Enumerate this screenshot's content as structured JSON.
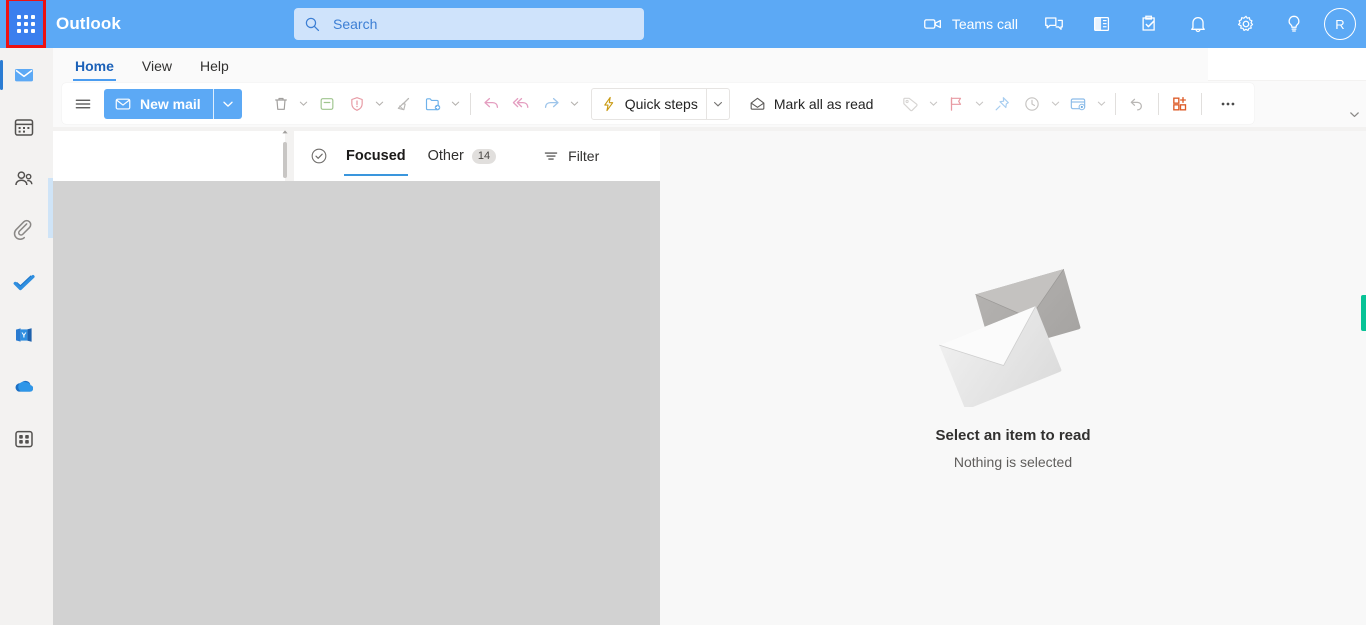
{
  "header": {
    "brand": "Outlook",
    "app_launcher_icon": "waffle-grid-icon",
    "search": {
      "placeholder": "Search",
      "icon": "search-icon"
    },
    "actions": [
      {
        "name": "teams-call",
        "label": "Teams call",
        "icon": "video-camera-icon"
      },
      {
        "name": "chat",
        "label": "",
        "icon": "chat-bubble-icon"
      },
      {
        "name": "office-apps",
        "label": "",
        "icon": "office-app-icon"
      },
      {
        "name": "tasks",
        "label": "",
        "icon": "task-checklist-icon"
      },
      {
        "name": "notifications",
        "label": "",
        "icon": "bell-icon"
      },
      {
        "name": "settings",
        "label": "",
        "icon": "gear-icon"
      },
      {
        "name": "help",
        "label": "",
        "icon": "lightbulb-icon"
      }
    ],
    "avatar_initial": "R"
  },
  "rail": {
    "items": [
      {
        "name": "mail",
        "icon": "mail-icon",
        "active": true
      },
      {
        "name": "calendar",
        "icon": "calendar-icon",
        "active": false
      },
      {
        "name": "people",
        "icon": "people-icon",
        "active": false
      },
      {
        "name": "files",
        "icon": "paperclip-icon",
        "active": false
      },
      {
        "name": "to-do",
        "icon": "checkmark-icon",
        "active": false
      },
      {
        "name": "viva-engage",
        "icon": "yammer-icon",
        "active": false
      },
      {
        "name": "onedrive",
        "icon": "cloud-icon",
        "active": false
      },
      {
        "name": "more-apps",
        "icon": "apps-grid-icon",
        "active": false
      }
    ]
  },
  "ribbon_tabs": [
    {
      "label": "Home",
      "selected": true
    },
    {
      "label": "View",
      "selected": false
    },
    {
      "label": "Help",
      "selected": false
    }
  ],
  "toolbar": {
    "menu_icon": "hamburger-icon",
    "new_mail_label": "New mail",
    "new_mail_icon": "envelope-icon",
    "new_mail_caret": "chevron-down-icon",
    "quick_steps_label": "Quick steps",
    "quick_steps_icon": "lightning-bolt-icon",
    "mark_all_read_label": "Mark all as read",
    "mark_all_read_icon": "open-envelope-icon",
    "items": [
      {
        "name": "delete",
        "icon": "trash-icon",
        "caret": true
      },
      {
        "name": "archive",
        "icon": "archive-icon",
        "caret": false
      },
      {
        "name": "report",
        "icon": "shield-exclamation-icon",
        "caret": true
      },
      {
        "name": "sweep",
        "icon": "broom-icon",
        "caret": false
      },
      {
        "name": "move-to",
        "icon": "folder-arrow-icon",
        "caret": true
      },
      {
        "name": "reply",
        "icon": "reply-arrow-icon",
        "caret": false
      },
      {
        "name": "reply-all",
        "icon": "reply-all-arrow-icon",
        "caret": false
      },
      {
        "name": "forward",
        "icon": "forward-arrow-icon",
        "caret": true
      },
      {
        "name": "tag",
        "icon": "tag-icon",
        "caret": true
      },
      {
        "name": "flag",
        "icon": "flag-icon",
        "caret": true
      },
      {
        "name": "pin",
        "icon": "pin-icon",
        "caret": false
      },
      {
        "name": "snooze",
        "icon": "clock-icon",
        "caret": true
      },
      {
        "name": "rules",
        "icon": "rules-gear-icon",
        "caret": true
      },
      {
        "name": "undo",
        "icon": "undo-arrow-icon",
        "caret": false
      },
      {
        "name": "add-ins",
        "icon": "addins-plus-icon",
        "caret": false
      },
      {
        "name": "more-commands",
        "icon": "ellipsis-icon",
        "caret": false
      }
    ],
    "collapse_icon": "chevron-down-icon"
  },
  "message_list": {
    "select_all_icon": "circle-check-icon",
    "tabs": [
      {
        "label": "Focused",
        "badge": "",
        "selected": true
      },
      {
        "label": "Other",
        "badge": "14",
        "selected": false
      }
    ],
    "filter_label": "Filter",
    "filter_icon": "filter-lines-icon"
  },
  "reading_pane": {
    "illustration": "two-envelopes-icon",
    "title": "Select an item to read",
    "subtitle": "Nothing is selected"
  },
  "colors": {
    "header_blue": "#5CA9F5",
    "launcher_blue": "#3B7FEE",
    "highlight_red": "#ee1111",
    "search_field": "#CFE3FB",
    "accent_tab": "#3a96dd",
    "green_indicator": "#07c396",
    "placeholder_gray": "#d2d2d2"
  }
}
